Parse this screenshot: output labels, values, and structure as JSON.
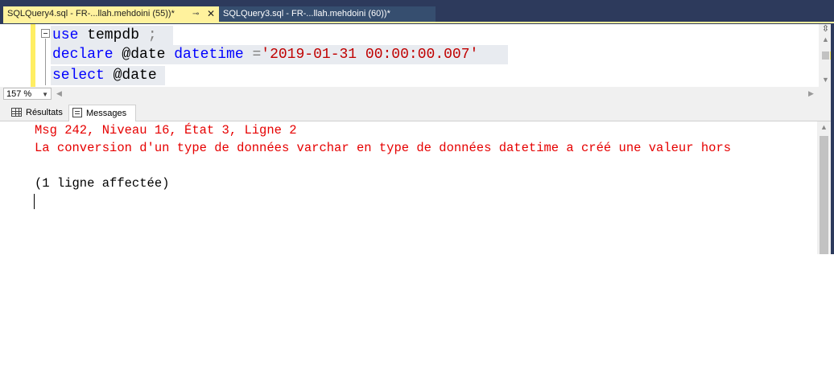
{
  "tabs": [
    {
      "title": "SQLQuery4.sql - FR-...llah.mehdoini (55))*",
      "active": true
    },
    {
      "title": "SQLQuery3.sql - FR-...llah.mehdoini (60))*",
      "active": false
    }
  ],
  "tab_icons": {
    "pin": "pin-icon",
    "close": "close-icon"
  },
  "editor": {
    "line1": {
      "kw": "use",
      "rest": " tempdb ",
      "punct": ";"
    },
    "line2": {
      "kw1": "declare",
      "var": " @date ",
      "kw2": "datetime",
      "op": " =",
      "str": "'2019-01-31 00:00:00.007'"
    },
    "line3": {
      "kw": "select",
      "var": " @date"
    }
  },
  "zoom": {
    "value": "157 %"
  },
  "results_tabs": [
    {
      "label": "Résultats",
      "icon": "grid-icon"
    },
    {
      "label": "Messages",
      "icon": "messages-icon",
      "active": true
    }
  ],
  "messages": [
    "Msg 242, Niveau 16, État 3, Ligne 2",
    "La conversion d'un type de données varchar en type de données datetime a créé une valeur hors",
    "",
    "(1 ligne affectée)"
  ],
  "colors": {
    "keyword": "#0000ff",
    "string": "#c00000",
    "error": "#e60000",
    "active_tab": "#fff29d",
    "tab_strip": "#2d3a5c"
  }
}
